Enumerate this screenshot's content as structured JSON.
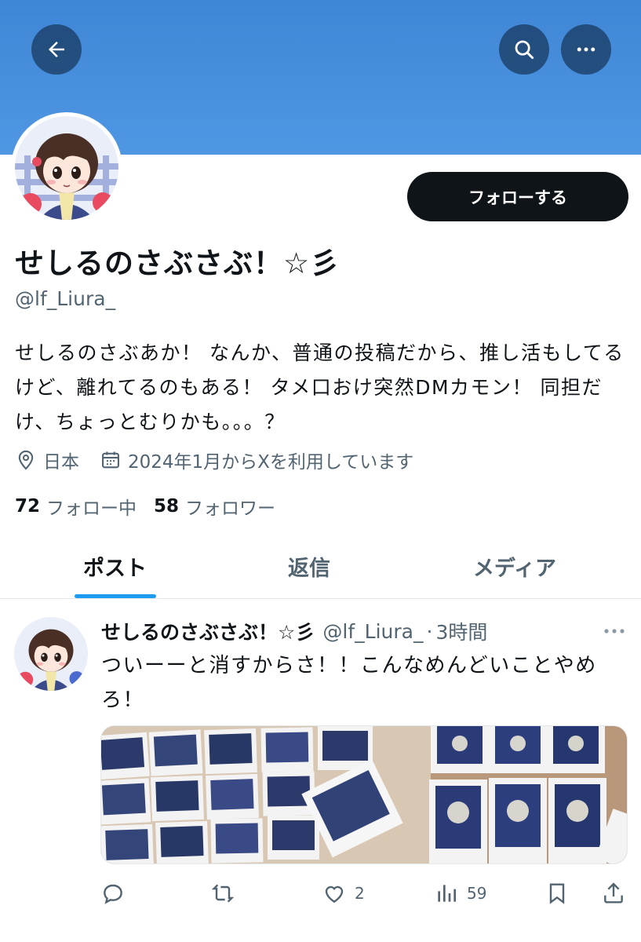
{
  "header": {
    "back_icon": "arrow-left-icon",
    "search_icon": "search-icon",
    "more_icon": "more-horizontal-icon",
    "banner_color": "#4a90de"
  },
  "profile": {
    "follow_label": "フォローする",
    "display_name": "せしるのさぶさぶ！☆彡",
    "handle": "@lf_Liura_",
    "bio": "せしるのさぶあか！ なんか、普通の投稿だから、推し活もしてるけど、離れてるのもある！ タメ口おけ突然DMカモン！ 同担だけ、ちょっとむりかも。。。？",
    "location": "日本",
    "joined": "2024年1月からXを利用しています",
    "following_count": "72",
    "following_label": "フォロー中",
    "followers_count": "58",
    "followers_label": "フォロワー"
  },
  "tabs": [
    {
      "label": "ポスト",
      "active": true
    },
    {
      "label": "返信",
      "active": false
    },
    {
      "label": "メディア",
      "active": false
    }
  ],
  "post": {
    "name": "せしるのさぶさぶ！☆彡",
    "handle": "@lf_Liura_",
    "separator": "·",
    "time": "3時間",
    "text": "ついーーと消すからさ！！こんなめんどいことやめろ！",
    "actions": {
      "reply_count": "",
      "repost_count": "",
      "like_count": "2",
      "views_count": "59"
    }
  },
  "colors": {
    "accent": "#1d9bf0",
    "text_primary": "#0f1419",
    "text_secondary": "#536471",
    "follow_button": "#0f1419"
  }
}
